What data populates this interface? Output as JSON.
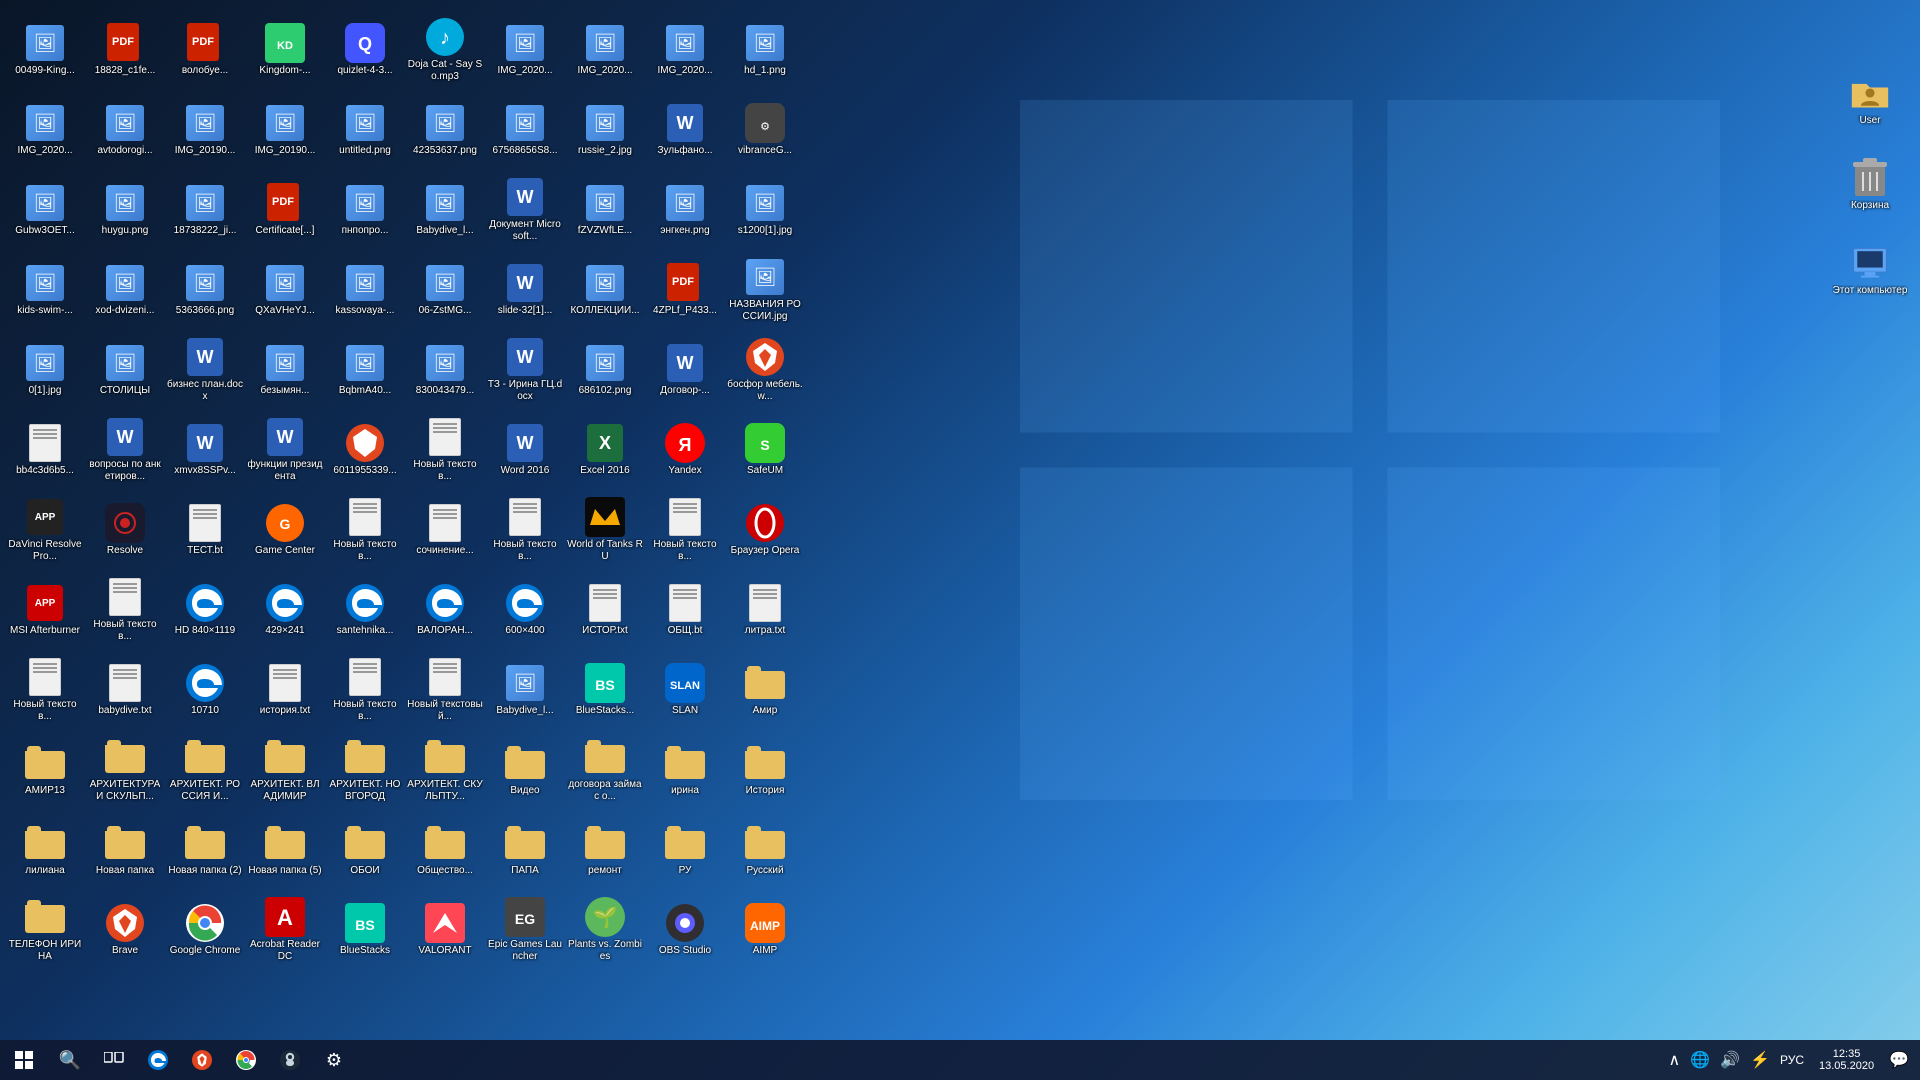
{
  "desktop": {
    "background": "windows-10-blue-gradient"
  },
  "icons": [
    {
      "id": "icon-00499",
      "label": "00499-King...",
      "type": "image",
      "color": "#8B4513"
    },
    {
      "id": "icon-img2020-1",
      "label": "IMG_2020...",
      "type": "image",
      "color": "#5ba3f5"
    },
    {
      "id": "icon-gubw",
      "label": "Gubw3OET...",
      "type": "image",
      "color": "#5ba3f5"
    },
    {
      "id": "icon-kids",
      "label": "kids-swim-...",
      "type": "image",
      "color": "#5ba3f5"
    },
    {
      "id": "icon-01jpg",
      "label": "0[1].jpg",
      "type": "image",
      "color": "#5ba3f5"
    },
    {
      "id": "icon-bb4c3d",
      "label": "bb4c3d6b5...",
      "type": "txt",
      "color": "#ccc"
    },
    {
      "id": "icon-davinci",
      "label": "DaVinci Resolve Pro...",
      "type": "app",
      "color": "#222"
    },
    {
      "id": "icon-msi",
      "label": "MSI Afterburner",
      "type": "app",
      "color": "#cc0000"
    },
    {
      "id": "icon-novtxt1",
      "label": "Новый текстов...",
      "type": "txt",
      "color": "#ccc"
    },
    {
      "id": "icon-amir13",
      "label": "АМИР13",
      "type": "folder",
      "color": "#e8c060"
    },
    {
      "id": "icon-liliana",
      "label": "лилиана",
      "type": "folder",
      "color": "#e8c060"
    },
    {
      "id": "icon-telefon",
      "label": "ТЕЛЕФОН ИРИНА",
      "type": "folder",
      "color": "#e8c060"
    },
    {
      "id": "icon-18828",
      "label": "18828_c1fe...",
      "type": "pdf",
      "color": "#cc0000"
    },
    {
      "id": "icon-avtodorogi",
      "label": "avtodorogi...",
      "type": "image",
      "color": "#5ba3f5"
    },
    {
      "id": "icon-huygu",
      "label": "huygu.png",
      "type": "image",
      "color": "#5ba3f5"
    },
    {
      "id": "icon-xodvizeni",
      "label": "xod-dvizeni...",
      "type": "image",
      "color": "#5ba3f5"
    },
    {
      "id": "icon-stolicy",
      "label": "СТОЛИЦЫ",
      "type": "image",
      "color": "#5ba3f5"
    },
    {
      "id": "icon-voprosy",
      "label": "вопросы по анкетиров...",
      "type": "word",
      "color": "#2b5eb5"
    },
    {
      "id": "icon-resolve",
      "label": "Resolve",
      "type": "app-davinci",
      "color": "#222"
    },
    {
      "id": "icon-novtxt2",
      "label": "Новый текстов...",
      "type": "txt",
      "color": "#ccc"
    },
    {
      "id": "icon-babydive",
      "label": "babydive.txt",
      "type": "txt",
      "color": "#ccc"
    },
    {
      "id": "icon-arhit1",
      "label": "АРХИТЕКТУРА И СКУЛЬП...",
      "type": "folder",
      "color": "#e8c060"
    },
    {
      "id": "icon-novpap1",
      "label": "Новая папка",
      "type": "folder",
      "color": "#e8c060"
    },
    {
      "id": "icon-brave",
      "label": "Brave",
      "type": "app-brave",
      "color": "#f44"
    },
    {
      "id": "icon-voloby",
      "label": "волобуе...",
      "type": "pdf",
      "color": "#cc0000"
    },
    {
      "id": "icon-img2019-2",
      "label": "IMG_20190...",
      "type": "image",
      "color": "#5ba3f5"
    },
    {
      "id": "icon-18738",
      "label": "18738222_ji...",
      "type": "image",
      "color": "#5ba3f5"
    },
    {
      "id": "icon-5363",
      "label": "5363666.png",
      "type": "image",
      "color": "#5ba3f5"
    },
    {
      "id": "icon-biznesplan",
      "label": "бизнес план.docx",
      "type": "word",
      "color": "#2b5eb5"
    },
    {
      "id": "icon-xmx",
      "label": "xmvx8SSPv...",
      "type": "word",
      "color": "#2b5eb5"
    },
    {
      "id": "icon-testtxt",
      "label": "ТЕСТ.bt",
      "type": "txt",
      "color": "#ccc"
    },
    {
      "id": "icon-hd840",
      "label": "HD 840×1119",
      "type": "app-edge",
      "color": "#0078d7"
    },
    {
      "id": "icon-10710",
      "label": "10710",
      "type": "app-edge",
      "color": "#0078d7"
    },
    {
      "id": "icon-arhitros",
      "label": "АРХИТЕКТ. РОССИЯ И...",
      "type": "folder",
      "color": "#e8c060"
    },
    {
      "id": "icon-novpap2",
      "label": "Новая папка (2)",
      "type": "folder",
      "color": "#e8c060"
    },
    {
      "id": "icon-gchrome",
      "label": "Google Chrome",
      "type": "app-chrome",
      "color": "#4285f4"
    },
    {
      "id": "icon-kingdom",
      "label": "Kingdom-...",
      "type": "app-kingdom",
      "color": "#2ecc71"
    },
    {
      "id": "icon-img2019-3",
      "label": "IMG_20190...",
      "type": "image",
      "color": "#5ba3f5"
    },
    {
      "id": "icon-certificate",
      "label": "Certificatе[...]",
      "type": "pdf",
      "color": "#cc0000"
    },
    {
      "id": "icon-qxavhe",
      "label": "QXaVHeYJ...",
      "type": "image",
      "color": "#5ba3f5"
    },
    {
      "id": "icon-bezymyan",
      "label": "безымян...",
      "type": "image",
      "color": "#5ba3f5"
    },
    {
      "id": "icon-funkprez",
      "label": "функции президента",
      "type": "word",
      "color": "#2b5eb5"
    },
    {
      "id": "icon-gamecenter",
      "label": "Game Center",
      "type": "app-game",
      "color": "#ff6600"
    },
    {
      "id": "icon-429x241",
      "label": "429×241",
      "type": "app-edge",
      "color": "#0078d7"
    },
    {
      "id": "icon-istoriatxt",
      "label": "история.txt",
      "type": "txt",
      "color": "#ccc"
    },
    {
      "id": "icon-arhitvlad",
      "label": "АРХИТЕКТ. ВЛАДИМИР",
      "type": "folder",
      "color": "#e8c060"
    },
    {
      "id": "icon-novpap5",
      "label": "Новая папка (5)",
      "type": "folder",
      "color": "#e8c060"
    },
    {
      "id": "icon-acrobat",
      "label": "Acrobat Reader DC",
      "type": "app-acrobat",
      "color": "#cc0000"
    },
    {
      "id": "icon-quizlet",
      "label": "quizlet-4-3...",
      "type": "app-quizlet",
      "color": "#4255ff"
    },
    {
      "id": "icon-untitled",
      "label": "untitled.png",
      "type": "image",
      "color": "#5ba3f5"
    },
    {
      "id": "icon-pnpoprop",
      "label": "пнпопро...",
      "type": "image",
      "color": "#5ba3f5"
    },
    {
      "id": "icon-kassovaya",
      "label": "kassovaya-...",
      "type": "image",
      "color": "#5ba3f5"
    },
    {
      "id": "icon-bqbm",
      "label": "BqbmA40...",
      "type": "image",
      "color": "#5ba3f5"
    },
    {
      "id": "icon-60119",
      "label": "6011955339...",
      "type": "app-brave-red",
      "color": "#e2461f"
    },
    {
      "id": "icon-novtxt3",
      "label": "Новый текстов...",
      "type": "txt",
      "color": "#ccc"
    },
    {
      "id": "icon-santehnika",
      "label": "santehnika...",
      "type": "app-edge",
      "color": "#0078d7"
    },
    {
      "id": "icon-novtxt4",
      "label": "Новый текстов...",
      "type": "txt",
      "color": "#ccc"
    },
    {
      "id": "icon-arhitnov",
      "label": "АРХИТЕКТ. НОВГОРОД",
      "type": "folder",
      "color": "#e8c060"
    },
    {
      "id": "icon-oboi",
      "label": "ОБОИ",
      "type": "folder",
      "color": "#e8c060"
    },
    {
      "id": "icon-bluestacks",
      "label": "BlueStacks",
      "type": "app-bluestacks",
      "color": "#00c8aa"
    },
    {
      "id": "icon-doja",
      "label": "Doja Cat - Say So.mp3",
      "type": "app-music",
      "color": "#00aadd"
    },
    {
      "id": "icon-42353",
      "label": "42353637.png",
      "type": "image",
      "color": "#5ba3f5"
    },
    {
      "id": "icon-babydive2",
      "label": "Babydive_l...",
      "type": "image",
      "color": "#5ba3f5"
    },
    {
      "id": "icon-06zst",
      "label": "06-ZstMG...",
      "type": "image",
      "color": "#5ba3f5"
    },
    {
      "id": "icon-830043",
      "label": "830043479...",
      "type": "image",
      "color": "#5ba3f5"
    },
    {
      "id": "icon-novtxt5",
      "label": "Новый текстов...",
      "type": "txt",
      "color": "#ccc"
    },
    {
      "id": "icon-sochinenie",
      "label": "сочинение...",
      "type": "txt",
      "color": "#ccc"
    },
    {
      "id": "icon-valorant2",
      "label": "ВАЛОРАН...",
      "type": "app-edge",
      "color": "#0078d7"
    },
    {
      "id": "icon-novtxt6",
      "label": "Новый текстовый...",
      "type": "txt",
      "color": "#ccc"
    },
    {
      "id": "icon-arhitskulp",
      "label": "АРХИТЕКТ. СКУЛЬПТУ...",
      "type": "folder",
      "color": "#e8c060"
    },
    {
      "id": "icon-obshchestvo",
      "label": "Общество...",
      "type": "folder",
      "color": "#e8c060"
    },
    {
      "id": "icon-valorant",
      "label": "VALORANT",
      "type": "app-valorant",
      "color": "#ff4655"
    },
    {
      "id": "icon-img2020-2",
      "label": "IMG_2020...",
      "type": "image",
      "color": "#5ba3f5"
    },
    {
      "id": "icon-67568",
      "label": "67568656S8...",
      "type": "image",
      "color": "#5ba3f5"
    },
    {
      "id": "icon-dokum",
      "label": "Документ Microsoft...",
      "type": "word",
      "color": "#2b5eb5"
    },
    {
      "id": "icon-slide32",
      "label": "slide-32[1]...",
      "type": "word",
      "color": "#2b5eb5"
    },
    {
      "id": "icon-tz",
      "label": "ТЗ - Ирина ГЦ.docx",
      "type": "word",
      "color": "#2b5eb5"
    },
    {
      "id": "icon-word2016",
      "label": "Word 2016",
      "type": "app-word",
      "color": "#2b5eb5"
    },
    {
      "id": "icon-novtxt7",
      "label": "Новый текстов...",
      "type": "txt",
      "color": "#ccc"
    },
    {
      "id": "icon-600x400",
      "label": "600×400",
      "type": "app-edge",
      "color": "#0078d7"
    },
    {
      "id": "icon-babydive3",
      "label": "Babydive_l...",
      "type": "image",
      "color": "#5ba3f5"
    },
    {
      "id": "icon-video",
      "label": "Видео",
      "type": "folder-special",
      "color": "#e8c060"
    },
    {
      "id": "icon-papa",
      "label": "ПАПА",
      "type": "folder",
      "color": "#e8c060"
    },
    {
      "id": "icon-epic",
      "label": "Epic Games Launcher",
      "type": "app-epic",
      "color": "#444"
    },
    {
      "id": "icon-img2020-3",
      "label": "IMG_2020...",
      "type": "image",
      "color": "#5ba3f5"
    },
    {
      "id": "icon-russie2",
      "label": "russie_2.jpg",
      "type": "image",
      "color": "#5ba3f5"
    },
    {
      "id": "icon-fzvzwr",
      "label": "fZVZWfLE...",
      "type": "image",
      "color": "#5ba3f5"
    },
    {
      "id": "icon-kollek",
      "label": "КОЛЛЕКЦИИ...",
      "type": "image",
      "color": "#5ba3f5"
    },
    {
      "id": "icon-686102",
      "label": "686102.png",
      "type": "image",
      "color": "#5ba3f5"
    },
    {
      "id": "icon-excel2016",
      "label": "Excel 2016",
      "type": "app-excel",
      "color": "#1d6e3d"
    },
    {
      "id": "icon-wot",
      "label": "World of Tanks RU",
      "type": "app-wot",
      "color": "#f4a800"
    },
    {
      "id": "icon-istoror",
      "label": "ИСТОР.txt",
      "type": "txt",
      "color": "#ccc"
    },
    {
      "id": "icon-bluestacks2",
      "label": "BlueStacks...",
      "type": "app-bluestacks",
      "color": "#00c8aa"
    },
    {
      "id": "icon-dogovor",
      "label": "договора займа с о...",
      "type": "folder",
      "color": "#e8c060"
    },
    {
      "id": "icon-remont",
      "label": "ремонт",
      "type": "folder",
      "color": "#e8c060"
    },
    {
      "id": "icon-plants",
      "label": "Plants vs. Zombies",
      "type": "app-plants",
      "color": "#5cb85c"
    },
    {
      "id": "icon-img2020-4",
      "label": "IMG_2020...",
      "type": "image",
      "color": "#5ba3f5"
    },
    {
      "id": "icon-zulfan",
      "label": "Зульфано...",
      "type": "word",
      "color": "#2b5eb5"
    },
    {
      "id": "icon-engken",
      "label": "энгкен.png",
      "type": "image",
      "color": "#5ba3f5"
    },
    {
      "id": "icon-4zplf",
      "label": "4ZPLf_P433...",
      "type": "pdf",
      "color": "#cc0000"
    },
    {
      "id": "icon-dogovor2",
      "label": "Договор-...",
      "type": "word",
      "color": "#2b5eb5"
    },
    {
      "id": "icon-yandex",
      "label": "Yandex",
      "type": "app-yandex",
      "color": "#f00"
    },
    {
      "id": "icon-novtxt8",
      "label": "Новый текстов...",
      "type": "txt",
      "color": "#ccc"
    },
    {
      "id": "icon-obshtxt",
      "label": "ОБЩ.bt",
      "type": "txt",
      "color": "#ccc"
    },
    {
      "id": "icon-slan",
      "label": "SLAN",
      "type": "app-slan",
      "color": "#0066cc"
    },
    {
      "id": "icon-irina2",
      "label": "ирина",
      "type": "folder",
      "color": "#e8c060"
    },
    {
      "id": "icon-ry",
      "label": "РУ",
      "type": "folder",
      "color": "#e8c060"
    },
    {
      "id": "icon-obs",
      "label": "OBS Studio",
      "type": "app-obs",
      "color": "#302e31"
    },
    {
      "id": "icon-hd1",
      "label": "hd_1.png",
      "type": "image",
      "color": "#5ba3f5"
    },
    {
      "id": "icon-vibrance",
      "label": "vibranceG...",
      "type": "app-vibrance",
      "color": "#444"
    },
    {
      "id": "icon-s1200",
      "label": "s1200[1].jpg",
      "type": "image",
      "color": "#5ba3f5"
    },
    {
      "id": "icon-nazvan",
      "label": "НАЗВАНИЯ РОССИИ.jpg",
      "type": "image",
      "color": "#5ba3f5"
    },
    {
      "id": "icon-bosforbrav",
      "label": "босфор мебель.w...",
      "type": "app-brave2",
      "color": "#f44"
    },
    {
      "id": "icon-safeup",
      "label": "SafeUM",
      "type": "app-safeum",
      "color": "#33cc33"
    },
    {
      "id": "icon-opera",
      "label": "Браузер Opera",
      "type": "app-opera",
      "color": "#cc0000"
    },
    {
      "id": "icon-litra",
      "label": "литра.txt",
      "type": "txt",
      "color": "#ccc"
    },
    {
      "id": "icon-amir2",
      "label": "Амир",
      "type": "folder",
      "color": "#e8c060"
    },
    {
      "id": "icon-istoria",
      "label": "История",
      "type": "folder",
      "color": "#e8c060"
    },
    {
      "id": "icon-russky",
      "label": "Русский",
      "type": "folder",
      "color": "#e8c060"
    },
    {
      "id": "icon-aimp",
      "label": "AIMP",
      "type": "app-aimp",
      "color": "#ff6600"
    }
  ],
  "right_icons": [
    {
      "id": "icon-user",
      "label": "User",
      "type": "folder-user",
      "color": "#e8c060"
    },
    {
      "id": "icon-korzina",
      "label": "Корзина",
      "type": "trash",
      "color": "#888"
    },
    {
      "id": "icon-etotpc",
      "label": "Этот компьютер",
      "type": "mypc",
      "color": "#5ba3f5"
    }
  ],
  "taskbar": {
    "start_icon": "⊞",
    "time": "12:35",
    "date": "13.05.2020",
    "language": "РУС",
    "taskbar_apps": [
      {
        "id": "tb-search",
        "type": "search"
      },
      {
        "id": "tb-edge",
        "type": "edge"
      },
      {
        "id": "tb-brave",
        "type": "brave"
      },
      {
        "id": "tb-chrome",
        "type": "chrome"
      },
      {
        "id": "tb-steam",
        "type": "steam"
      },
      {
        "id": "tb-settings",
        "type": "settings"
      }
    ]
  }
}
